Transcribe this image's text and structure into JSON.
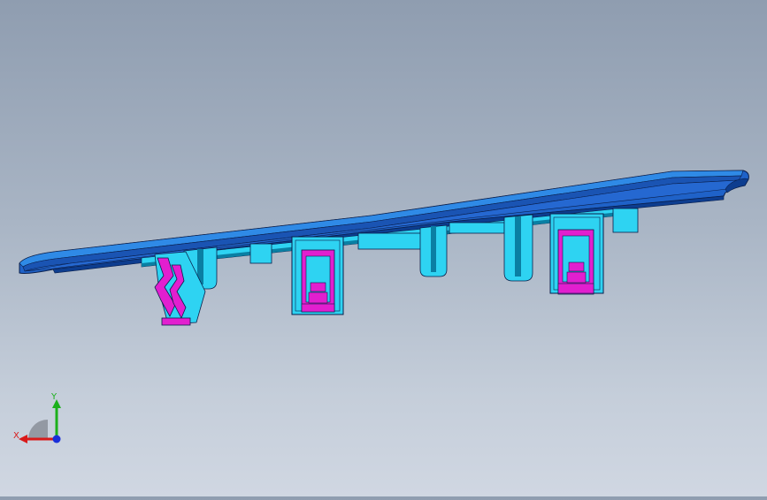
{
  "app": {
    "title": ""
  },
  "viewport": {
    "model_colors": {
      "shell_top": "#1f62c8",
      "shell_edge": "#0d3d8f",
      "shell_light": "#2f8ae6",
      "cyan_feature": "#2ed3f2",
      "cyan_dark": "#0a7fa3",
      "clip_magenta": "#e21fcf",
      "outline": "#0a1e4a"
    }
  },
  "triad": {
    "x_label": "X",
    "y_label": "Y",
    "x_color": "#d91a1a",
    "y_color": "#1cb01c",
    "z_color": "#1a2fd9"
  }
}
